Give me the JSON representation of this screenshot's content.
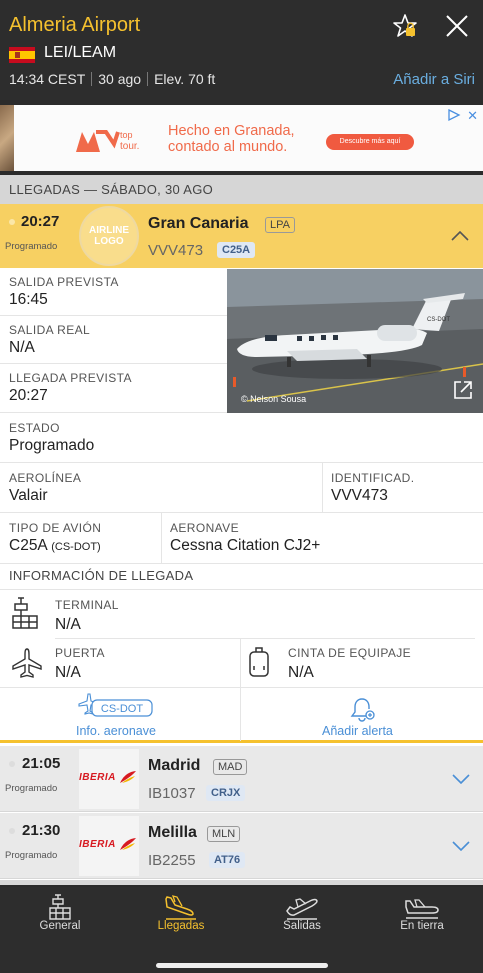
{
  "header": {
    "title": "Almeria Airport",
    "code": "LEI/LEAM",
    "time": "14:34 CEST",
    "date": "30 ago",
    "elevation": "Elev. 70 ft",
    "siri_label": "Añadir a Siri"
  },
  "ad": {
    "brand_line1": "top",
    "brand_line2": "tour.",
    "headline1": "Hecho en Granada,",
    "headline2": "contado al mundo.",
    "cta": "Descubre más aquí"
  },
  "section": {
    "title": "LLEGADAS — SÁBADO, 30 AGO"
  },
  "open_flight": {
    "time": "20:27",
    "status": "Programado",
    "logo_placeholder_l1": "AIRLINE",
    "logo_placeholder_l2": "LOGO",
    "city": "Gran Canaria",
    "city_code": "LPA",
    "flight_no": "VVV473",
    "aircraft_code": "C25A"
  },
  "details": {
    "dep_sched_label": "SALIDA PREVISTA",
    "dep_sched": "16:45",
    "dep_real_label": "SALIDA REAL",
    "dep_real": "N/A",
    "arr_sched_label": "LLEGADA PREVISTA",
    "arr_sched": "20:27",
    "status_label": "ESTADO",
    "status": "Programado",
    "airline_label": "AEROLÍNEA",
    "airline": "Valair",
    "ident_label": "IDENTIFICAD.",
    "ident": "VVV473",
    "actype_label": "TIPO DE AVIÓN",
    "actype": "C25A",
    "actype_reg": "(CS-DOT)",
    "aircraft_label": "AERONAVE",
    "aircraft": "Cessna Citation CJ2+",
    "photo_credit": "© Nelson Sousa",
    "photo_tail": "CS-DOT"
  },
  "arrival_info": {
    "title": "INFORMACIÓN DE LLEGADA",
    "terminal_label": "TERMINAL",
    "terminal": "N/A",
    "gate_label": "PUERTA",
    "gate": "N/A",
    "baggage_label": "CINTA DE EQUIPAJE",
    "baggage": "N/A"
  },
  "actions": {
    "aircraft_tag": "CS-DOT",
    "aircraft_info": "Info. aeronave",
    "add_alert": "Añadir alerta"
  },
  "flights": [
    {
      "time": "21:05",
      "status": "Programado",
      "airline": "IBERIA",
      "city": "Madrid",
      "city_code": "MAD",
      "flight_no": "IB1037",
      "aircraft_code": "CRJX"
    },
    {
      "time": "21:30",
      "status": "Programado",
      "airline": "IBERIA",
      "city": "Melilla",
      "city_code": "MLN",
      "flight_no": "IB2255",
      "aircraft_code": "AT76"
    }
  ],
  "tabs": [
    {
      "label": "General",
      "icon": "airport-tower-icon"
    },
    {
      "label": "Llegadas",
      "icon": "plane-landing-icon"
    },
    {
      "label": "Salidas",
      "icon": "plane-takeoff-icon"
    },
    {
      "label": "En tierra",
      "icon": "plane-on-ground-icon"
    }
  ],
  "colors": {
    "accent": "#f5c12e",
    "link": "#4a8fd6",
    "header_bg": "#2d2d2d",
    "iberia_red": "#d71a21"
  }
}
